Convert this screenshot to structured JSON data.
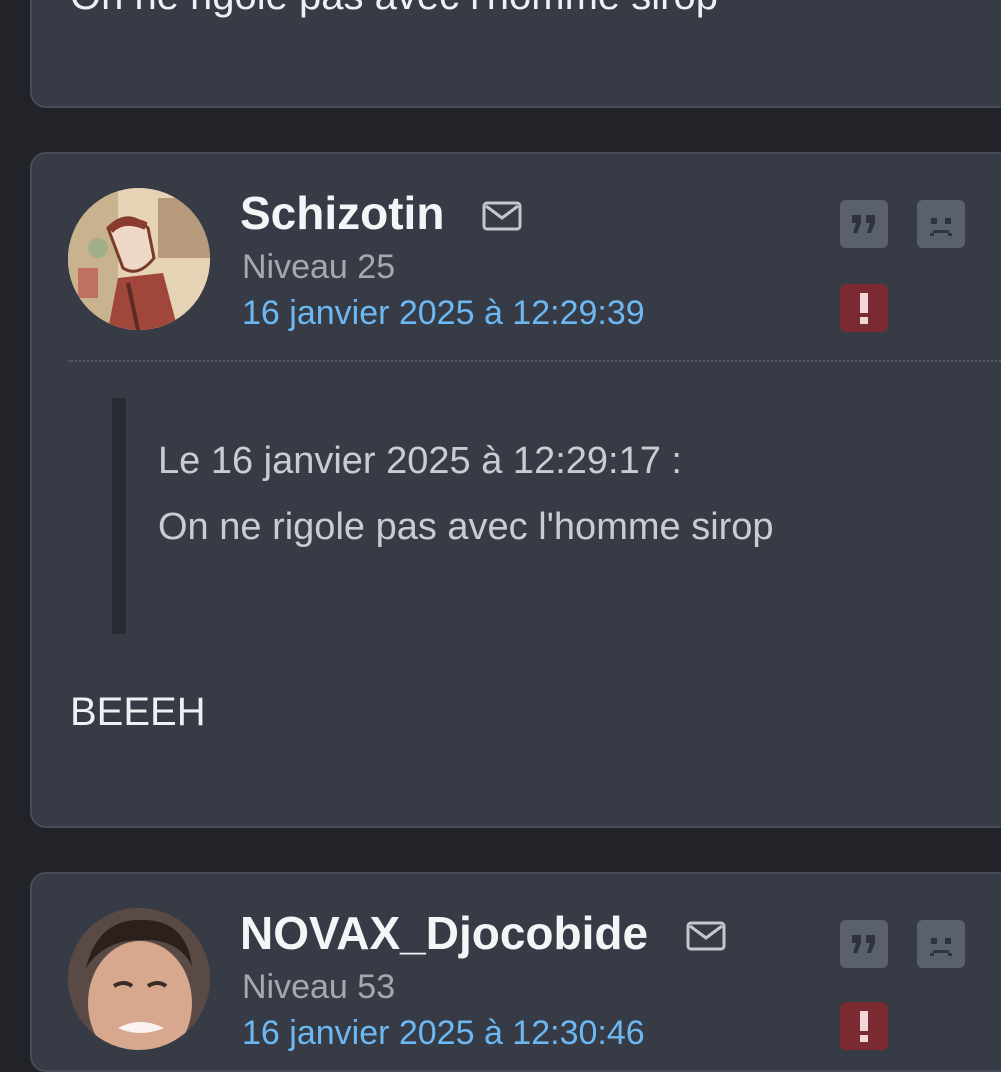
{
  "posts": [
    {
      "body": "On ne rigole pas avec l'homme sirop"
    },
    {
      "username": "Schizotin",
      "level": "Niveau 25",
      "date": "16 janvier 2025 à 12:29:39",
      "quote": {
        "meta": "Le 16 janvier 2025 à 12:29:17 :",
        "text": "On ne rigole pas avec l'homme sirop"
      },
      "body": "BEEEH"
    },
    {
      "username": "NOVAX_Djocobide",
      "level": "Niveau 53",
      "date": "16 janvier 2025 à 12:30:46"
    }
  ],
  "icons": {
    "mail": "mail-icon",
    "quote": "quote-icon",
    "sad": "sad-face-icon",
    "report": "exclamation-icon"
  },
  "colors": {
    "background": "#212328",
    "card": "#363b46",
    "date_link": "#6cb8f2",
    "report": "#7c2a31"
  }
}
